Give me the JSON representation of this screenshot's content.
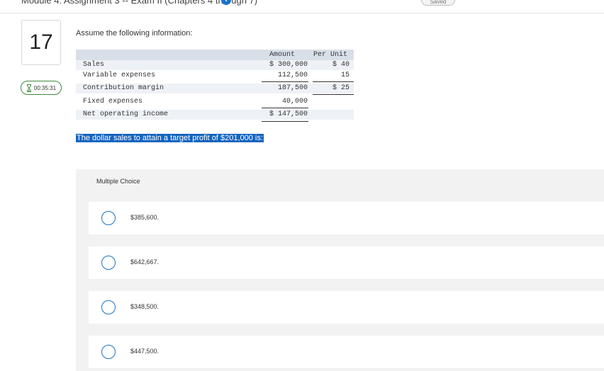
{
  "header": {
    "title": "Module 4: Assignment 3 -- Exam II (Chapters 4 through 7)",
    "info_icon": "i",
    "saved_label": "Saved"
  },
  "question": {
    "number": "17",
    "timer": "00:35:31",
    "prompt": "Assume the following information:",
    "target_question": "The dollar sales to attain a target profit of $201,000 is:"
  },
  "table": {
    "headers": {
      "amount": "Amount",
      "per_unit": "Per Unit"
    },
    "rows": [
      {
        "label": "Sales",
        "amount": "$ 300,000",
        "per_unit": "$ 40"
      },
      {
        "label": "Variable expenses",
        "amount": "112,500",
        "per_unit": "15"
      },
      {
        "label": "Contribution margin",
        "amount": "187,500",
        "per_unit": "$ 25"
      },
      {
        "label": "Fixed expenses",
        "amount": "40,000",
        "per_unit": ""
      },
      {
        "label": "Net operating income",
        "amount": "$ 147,500",
        "per_unit": ""
      }
    ]
  },
  "multiple_choice": {
    "title": "Multiple Choice",
    "options": [
      {
        "label": "$385,600."
      },
      {
        "label": "$642,667."
      },
      {
        "label": "$348,500."
      },
      {
        "label": "$447,500."
      }
    ]
  },
  "colors": {
    "accent_blue": "#1a73c8",
    "highlight_blue": "#1565c0",
    "timer_green": "#3b8a3b",
    "panel_gray": "#f2f2f2"
  }
}
